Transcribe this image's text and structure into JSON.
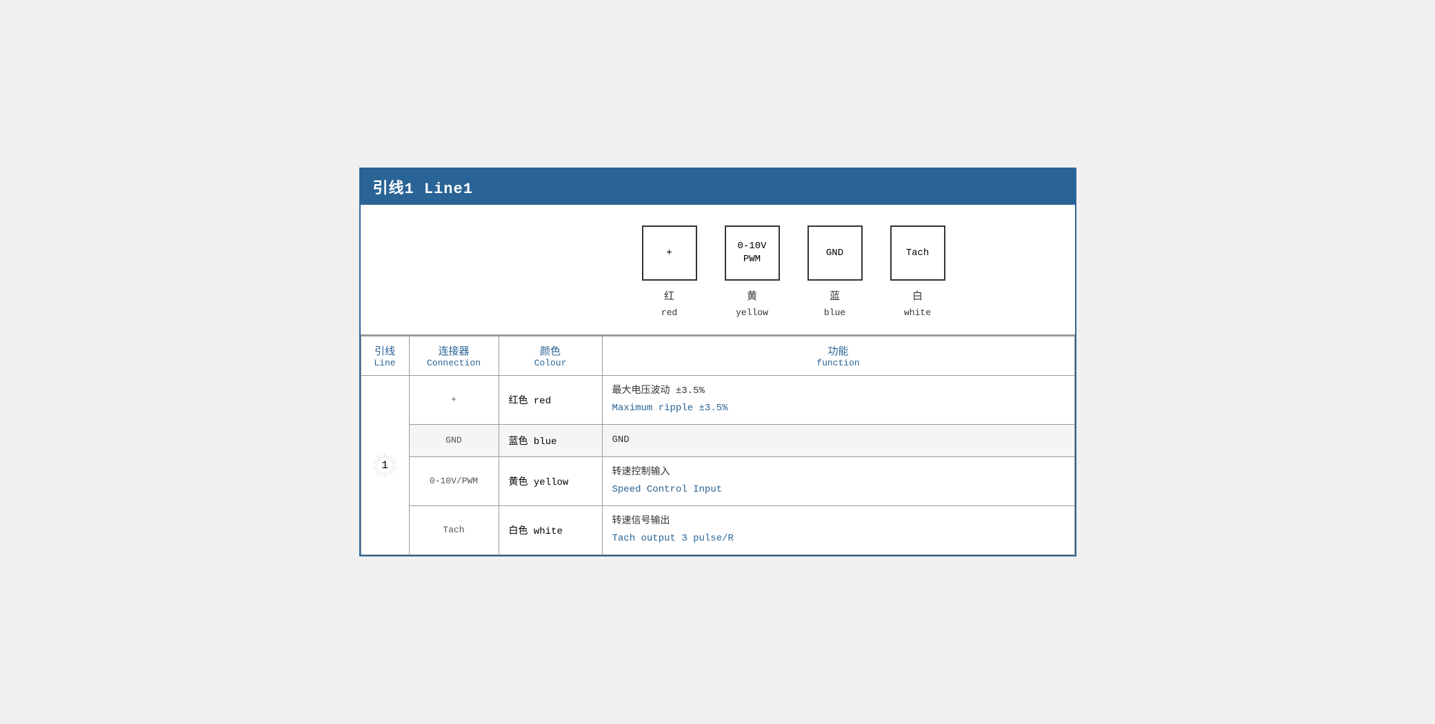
{
  "title": "引线1 Line1",
  "diagram": {
    "connectors": [
      {
        "id": "plus",
        "label": "+",
        "zh": "红",
        "en": "red"
      },
      {
        "id": "pwm",
        "label": "0-10V\nPWM",
        "zh": "黄",
        "en": "yellow"
      },
      {
        "id": "gnd",
        "label": "GND",
        "zh": "蓝",
        "en": "blue"
      },
      {
        "id": "tach",
        "label": "Tach",
        "zh": "白",
        "en": "white"
      }
    ]
  },
  "table": {
    "headers": {
      "line_zh": "引线",
      "line_en": "Line",
      "conn_zh": "连接器",
      "conn_en": "Connection",
      "color_zh": "颜色",
      "color_en": "Colour",
      "func_zh": "功能",
      "func_en": "function"
    },
    "rows": [
      {
        "line": "1",
        "connector": "+",
        "color_zh": "红色",
        "color_en": "red",
        "func_zh": "最大电压波动 ±3.5%",
        "func_en": "Maximum ripple ±3.5%"
      },
      {
        "line": "1",
        "connector": "GND",
        "color_zh": "蓝色",
        "color_en": "blue",
        "func_zh": "GND",
        "func_en": ""
      },
      {
        "line": "1",
        "connector": "0-10V/PWM",
        "color_zh": "黄色",
        "color_en": "yellow",
        "func_zh": "转速控制输入",
        "func_en": "Speed Control Input"
      },
      {
        "line": "1",
        "connector": "Tach",
        "color_zh": "白色",
        "color_en": "white",
        "func_zh": "转速信号输出",
        "func_en": "Tach output 3 pulse/R"
      }
    ]
  }
}
